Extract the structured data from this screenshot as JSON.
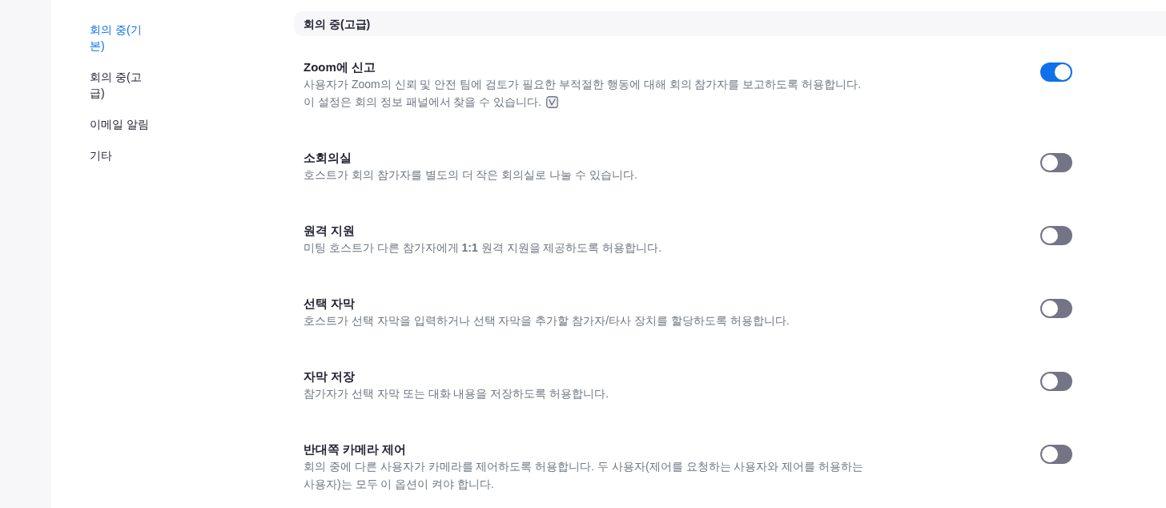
{
  "sidebar": {
    "items": [
      {
        "label": "회의 중(기본)",
        "selected": true
      },
      {
        "label": "회의 중(고급)",
        "selected": false
      },
      {
        "label": "이메일 알림",
        "selected": false
      },
      {
        "label": "기타",
        "selected": false
      }
    ]
  },
  "section": {
    "title": "회의 중(고급)"
  },
  "settings": [
    {
      "title": "Zoom에 신고",
      "description": "사용자가 Zoom의 신뢰 및 안전 팀에 검토가 필요한 부적절한 행동에 대해 회의 참가자를 보고하도록 허용합니다.",
      "note": "이 설정은 회의 정보 패널에서 찾을 수 있습니다.",
      "on": true
    },
    {
      "title": "소회의실",
      "description": "호스트가 회의 참가자를 별도의 더 작은 회의실로 나눌 수 있습니다.",
      "on": false
    },
    {
      "title": "원격 지원",
      "description": "미팅 호스트가 다른 참가자에게 **1:1** 원격 지원을 제공하도록 허용합니다.",
      "on": false
    },
    {
      "title": "선택 자막",
      "description": "호스트가 선택 자막을 입력하거나 선택 자막을 추가할 참가자/타사 장치를 할당하도록 허용합니다.",
      "on": false
    },
    {
      "title": "자막 저장",
      "description": "참가자가 선택 자막 또는 대화 내용을 저장하도록 허용합니다.",
      "on": false
    },
    {
      "title": "반대쪽 카메라 제어",
      "description": "회의 중에 다른 사용자가 카메라를 제어하도록 허용합니다. 두 사용자(제어를 요청하는 사용자와 제어를 허용하는 사용자)는 모두 이 옵션이 켜야 합니다.",
      "on": false
    }
  ]
}
